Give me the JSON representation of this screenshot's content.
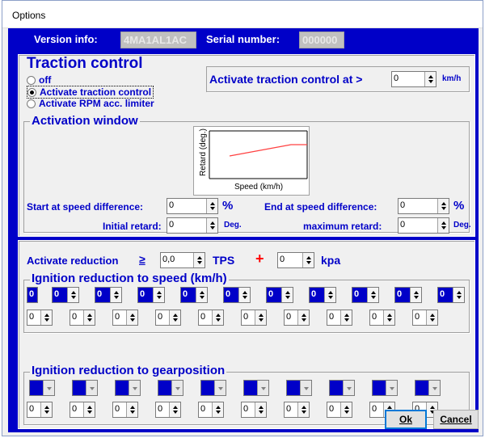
{
  "window": {
    "title": "Options"
  },
  "header": {
    "version_label": "Version info:",
    "version_value": "4MA1AL1AC",
    "serial_label": "Serial number:",
    "serial_value": "000000"
  },
  "traction": {
    "title": "Traction control",
    "options": [
      {
        "label": "off",
        "selected": false
      },
      {
        "label": "Activate traction control",
        "selected": true
      },
      {
        "label": "Activate RPM acc. limiter",
        "selected": false
      }
    ],
    "activate_at_label": "Activate traction control at >",
    "activate_at_value": "0",
    "activate_at_unit": "km/h"
  },
  "activation": {
    "title": "Activation window",
    "chart": {
      "ylabel": "Retard (deg.)",
      "xlabel": "Speed (km/h)"
    },
    "start_label": "Start at speed difference:",
    "start_value": "0",
    "start_unit": "%",
    "end_label": "End at speed difference:",
    "end_value": "0",
    "end_unit": "%",
    "initial_label": "Initial retard:",
    "initial_value": "0",
    "initial_unit": "Deg.",
    "max_label": "maximum retard:",
    "max_value": "0",
    "max_unit": "Deg."
  },
  "reduction": {
    "label": "Activate reduction",
    "geq": "≥",
    "tps_value": "0,0",
    "tps_unit": "TPS",
    "plus": "+",
    "kpa_value": "0",
    "kpa_unit": "kpa"
  },
  "speed_group": {
    "title": "Ignition reduction to speed (km/h)",
    "top_values": [
      "0",
      "0",
      "0",
      "0",
      "0",
      "0",
      "0",
      "0",
      "0",
      "0",
      "0"
    ],
    "bottom_values": [
      "0",
      "0",
      "0",
      "0",
      "0",
      "0",
      "0",
      "0",
      "0",
      "0"
    ]
  },
  "gear_group": {
    "title": "Ignition reduction to gearposition",
    "bottom_values": [
      "0",
      "0",
      "0",
      "0",
      "0",
      "0",
      "0",
      "0",
      "0",
      "0"
    ]
  },
  "buttons": {
    "ok": "Ok",
    "cancel": "Cancel"
  },
  "colors": {
    "accent": "#0000c8",
    "plus": "#ff0000",
    "line": "#ff4040"
  }
}
